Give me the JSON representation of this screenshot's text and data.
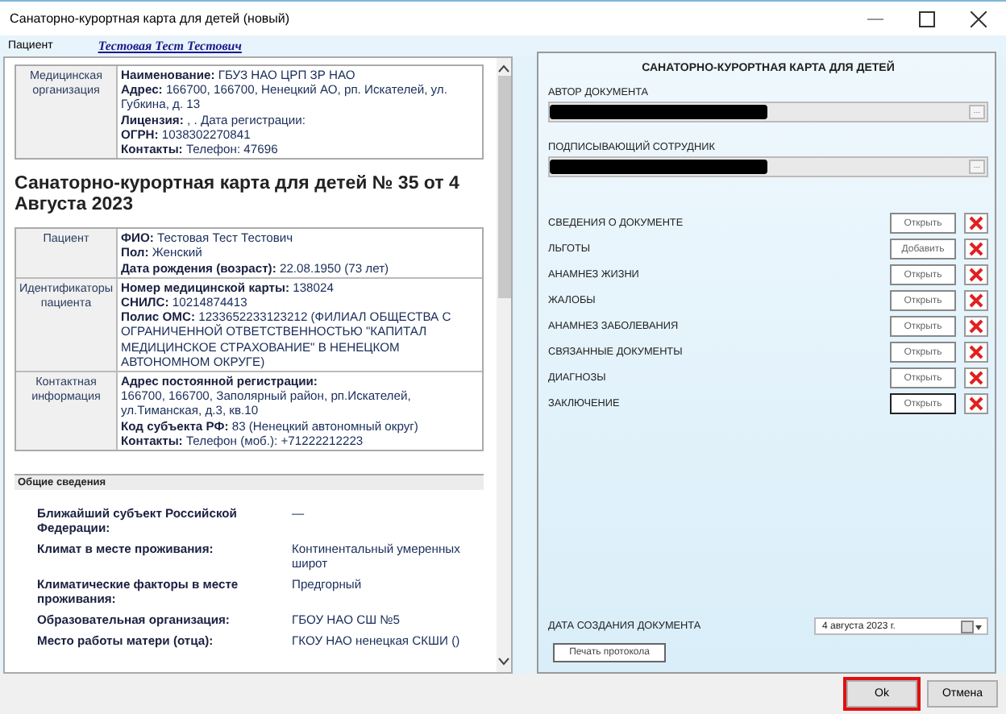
{
  "window": {
    "title": "Санаторно-курортная карта для детей (новый)"
  },
  "patient_bar": {
    "label": "Пациент",
    "name": "Тестовая Тест Тестович"
  },
  "document": {
    "org_table": [
      {
        "header": "Медицинская организация",
        "lines": [
          "**Наименование:** ГБУЗ НАО ЦРП ЗР НАО",
          "**Адрес:** 166700, 166700, Ненецкий АО, рп. Искателей, ул. Губкина, д. 13",
          "**Лицензия:** , . Дата регистрации:",
          "**ОГРН:** 1038302270841",
          "**Контакты:** Телефон: 47696"
        ]
      }
    ],
    "title": "Санаторно-курортная карта для детей № 35 от 4 Августа 2023",
    "patient_table": [
      {
        "header": "Пациент",
        "lines": [
          "**ФИО:** Тестовая Тест Тестович",
          "**Пол:** Женский",
          "**Дата рождения (возраст):** 22.08.1950 (73 лет)"
        ]
      },
      {
        "header": "Идентификаторы пациента",
        "lines": [
          "**Номер медицинской карты:** 138024",
          "**СНИЛС:** 10214874413",
          "**Полис ОМС:** 1233652233123212 (ФИЛИАЛ ОБЩЕСТВА С ОГРАНИЧЕННОЙ ОТВЕТСТВЕННОСТЬЮ \"КАПИТАЛ МЕДИЦИНСКОЕ СТРАХОВАНИЕ\" В НЕНЕЦКОМ АВТОНОМНОМ ОКРУГЕ)"
        ]
      },
      {
        "header": "Контактная информация",
        "lines": [
          "**Адрес постоянной регистрации:**",
          "166700, 166700, Заполярный район, рп.Искателей, ул.Тиманская, д.3, кв.10",
          "**Код субъекта РФ:** 83 (Ненецкий автономный округ)",
          "**Контакты:** Телефон (моб.): +71222212223"
        ]
      }
    ],
    "section_title": "Общие сведения",
    "general": [
      {
        "label": "Ближайший субъект Российской Федерации:",
        "value": "—"
      },
      {
        "label": "Климат в месте проживания:",
        "value": "Континентальный умеренных широт"
      },
      {
        "label": "Климатические факторы в месте проживания:",
        "value": "Предгорный"
      },
      {
        "label": "Образовательная организация:",
        "value": "ГБОУ НАО СШ №5"
      },
      {
        "label": "Место работы матери (отца):",
        "value": "ГКОУ НАО ненецкая СКШИ ()"
      }
    ]
  },
  "panel": {
    "title": "САНАТОРНО-КУРОРТНАЯ КАРТА ДЛЯ ДЕТЕЙ",
    "fields": [
      {
        "label": "АВТОР ДОКУМЕНТА",
        "redacted": true,
        "browse": "..."
      },
      {
        "label": "ПОДПИСЫВАЮЩИЙ СОТРУДНИК",
        "redacted": true,
        "browse": "..."
      }
    ],
    "sections": [
      {
        "label": "СВЕДЕНИЯ О ДОКУМЕНТЕ",
        "action": "Открыть",
        "focused": false
      },
      {
        "label": "ЛЬГОТЫ",
        "action": "Добавить",
        "focused": false
      },
      {
        "label": "АНАМНЕЗ ЖИЗНИ",
        "action": "Открыть",
        "focused": false
      },
      {
        "label": "ЖАЛОБЫ",
        "action": "Открыть",
        "focused": false
      },
      {
        "label": "АНАМНЕЗ ЗАБОЛЕВАНИЯ",
        "action": "Открыть",
        "focused": false
      },
      {
        "label": "СВЯЗАННЫЕ ДОКУМЕНТЫ",
        "action": "Открыть",
        "focused": false
      },
      {
        "label": "ДИАГНОЗЫ",
        "action": "Открыть",
        "focused": false
      },
      {
        "label": "ЗАКЛЮЧЕНИЕ",
        "action": "Открыть",
        "focused": true
      }
    ],
    "date": {
      "label": "ДАТА СОЗДАНИЯ ДОКУМЕНТА",
      "value": "4  августа  2023 г."
    },
    "print_button": "Печать протокола"
  },
  "footer": [
    {
      "label": "Ok",
      "highlighted": true
    },
    {
      "label": "Отмена",
      "highlighted": false
    }
  ]
}
